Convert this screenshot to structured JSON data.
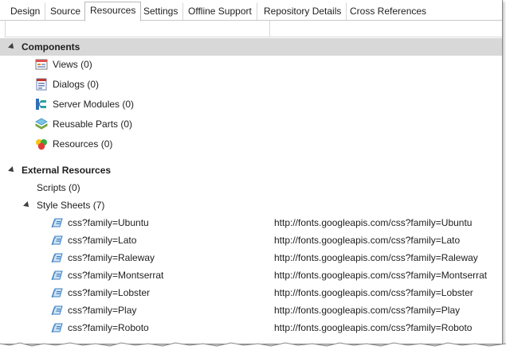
{
  "tabs": [
    {
      "label": "Design"
    },
    {
      "label": "Source"
    },
    {
      "label": "Resources",
      "active": true
    },
    {
      "label": "Settings"
    },
    {
      "label": "Offline Support"
    },
    {
      "label": "Repository Details"
    },
    {
      "label": "Cross References"
    }
  ],
  "tree": {
    "components": {
      "label": "Components",
      "items": [
        {
          "label": "Views (0)",
          "icon": "views-icon"
        },
        {
          "label": "Dialogs (0)",
          "icon": "dialogs-icon"
        },
        {
          "label": "Server Modules (0)",
          "icon": "server-modules-icon"
        },
        {
          "label": "Reusable Parts (0)",
          "icon": "reusable-parts-icon"
        },
        {
          "label": "Resources (0)",
          "icon": "resources-icon"
        }
      ]
    },
    "external": {
      "label": "External Resources",
      "scripts": "Scripts (0)",
      "stylesheets": {
        "label": "Style Sheets (7)",
        "items": [
          {
            "name": "css?family=Ubuntu",
            "url": "http://fonts.googleapis.com/css?family=Ubuntu"
          },
          {
            "name": "css?family=Lato",
            "url": "http://fonts.googleapis.com/css?family=Lato"
          },
          {
            "name": "css?family=Raleway",
            "url": "http://fonts.googleapis.com/css?family=Raleway"
          },
          {
            "name": "css?family=Montserrat",
            "url": "http://fonts.googleapis.com/css?family=Montserrat"
          },
          {
            "name": "css?family=Lobster",
            "url": "http://fonts.googleapis.com/css?family=Lobster"
          },
          {
            "name": "css?family=Play",
            "url": "http://fonts.googleapis.com/css?family=Play"
          },
          {
            "name": "css?family=Roboto",
            "url": "http://fonts.googleapis.com/css?family=Roboto"
          }
        ]
      }
    }
  },
  "colors": {
    "group_selected_bg": "#d8d8d8",
    "tab_border": "#b9b9b9",
    "stylesheet_icon": "#3a7fc1"
  }
}
